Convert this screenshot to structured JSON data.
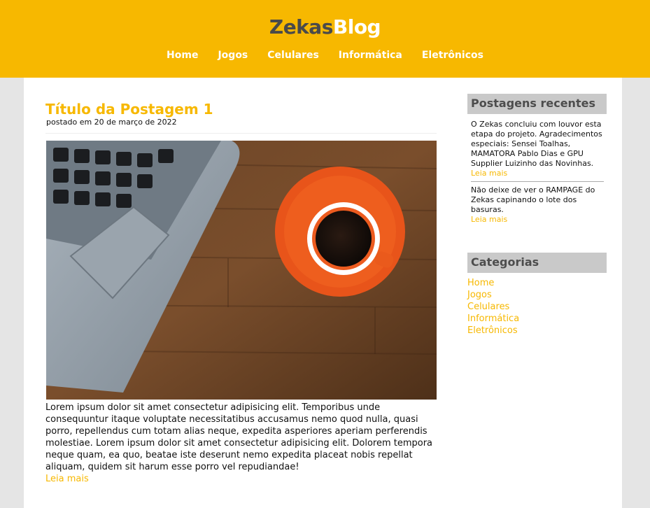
{
  "header": {
    "logo_part1": "Zekas",
    "logo_part2": "Blog",
    "nav": [
      "Home",
      "Jogos",
      "Celulares",
      "Informática",
      "Eletrônicos"
    ]
  },
  "post": {
    "title": "Título da Postagem 1",
    "meta": "postado em 20 de março de 2022",
    "body": "Lorem ipsum dolor sit amet consectetur adipisicing elit. Temporibus unde consequuntur itaque voluptate necessitatibus accusamus nemo quod nulla, quasi porro, repellendus cum totam alias neque, expedita asperiores aperiam perferendis molestiae. Lorem ipsum dolor sit amet consectetur adipisicing elit. Dolorem tempora neque quam, ea quo, beatae iste deserunt nemo expedita placeat nobis repellat aliquam, quidem sit harum esse porro vel repudiandae!",
    "read_more": "Leia mais"
  },
  "sidebar": {
    "recent_title": "Postagens recentes",
    "recent": [
      {
        "text": "O Zekas concluiu com louvor esta etapa do projeto. Agradecimentos especiais: Sensei Toalhas, MAMATORA Pablo Dias e GPU Supplier Luizinho das Novinhas.",
        "more": "Leia mais"
      },
      {
        "text": "Não deixe de ver o RAMPAGE do Zekas capinando o lote dos basuras.",
        "more": "Leia mais"
      }
    ],
    "categories_title": "Categorias",
    "categories": [
      "Home",
      "Jogos",
      "Celulares",
      "Informática",
      "Eletrônicos"
    ]
  },
  "colors": {
    "accent": "#f7b800",
    "logo_dark": "#4a4a4a",
    "sidebar_header_bg": "#c9c9c9",
    "page_bg": "#e5e5e5"
  }
}
